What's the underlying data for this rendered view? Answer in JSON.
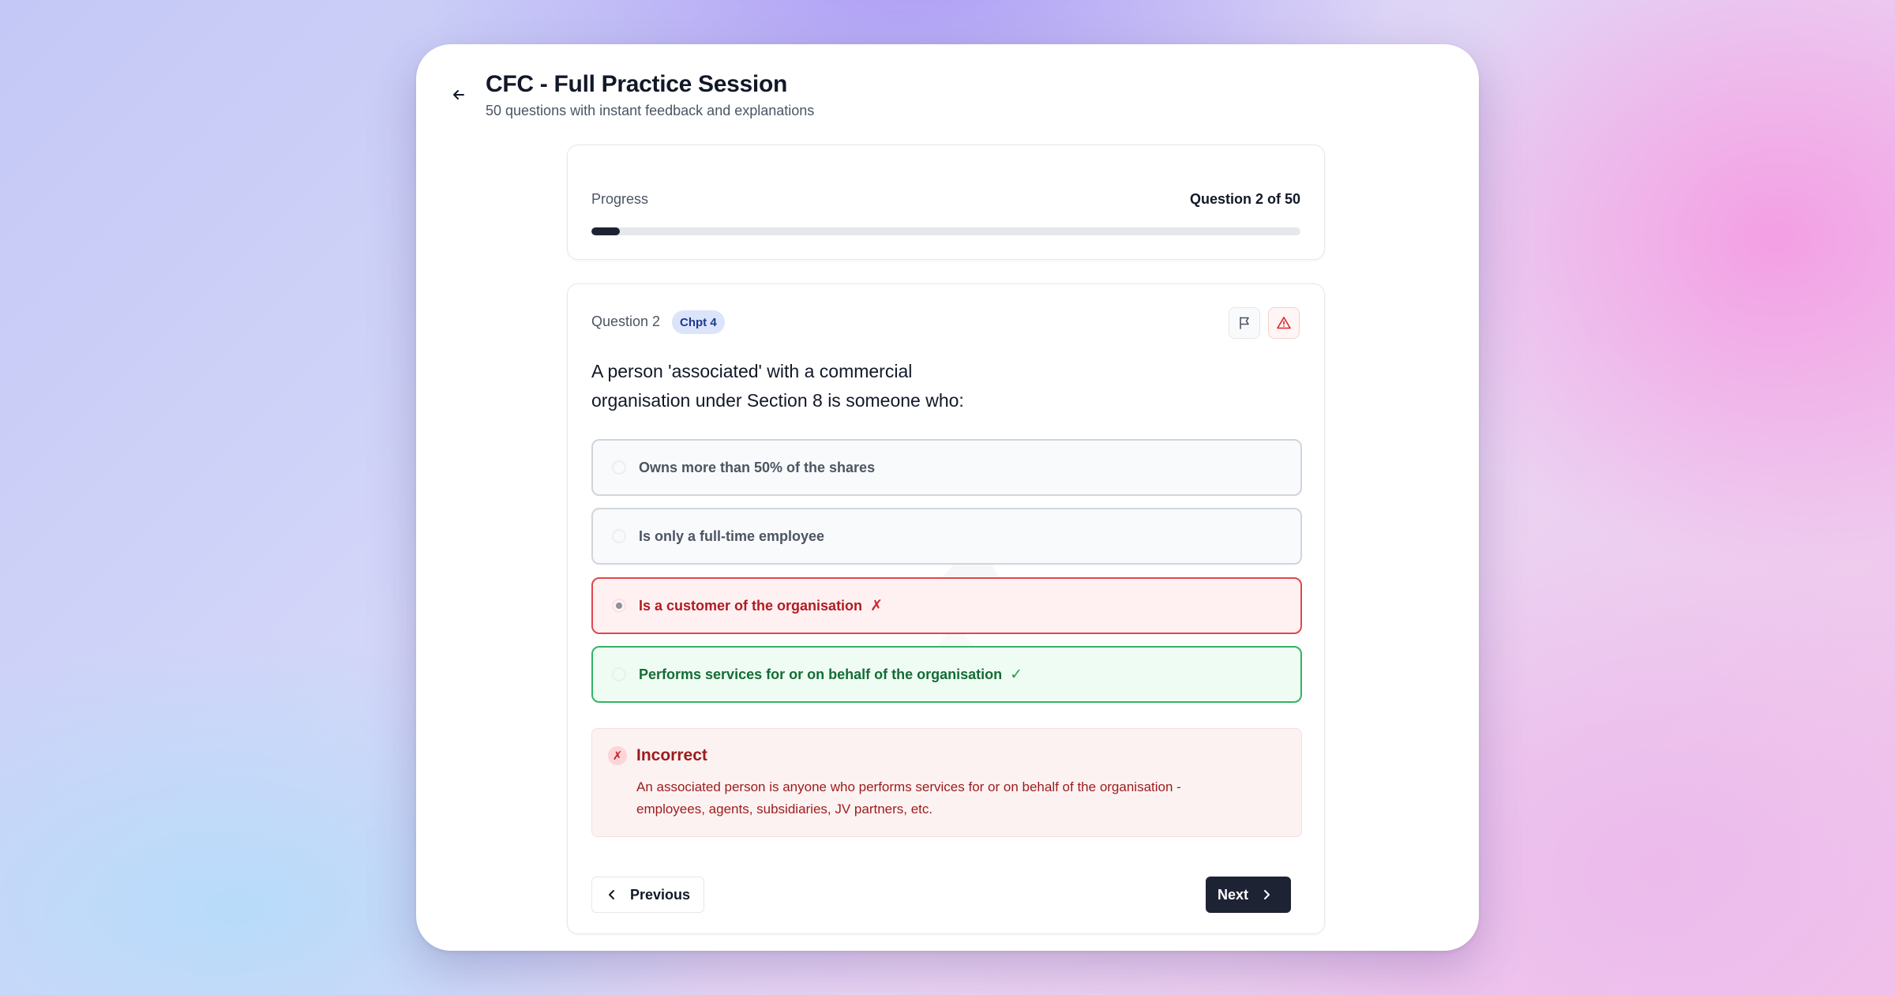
{
  "header": {
    "title": "CFC - Full Practice Session",
    "subtitle": "50 questions with instant feedback and explanations"
  },
  "progress": {
    "label": "Progress",
    "count_text": "Question 2 of 50",
    "current": 2,
    "total": 50,
    "fill_fraction": 0.04
  },
  "question": {
    "number_label": "Question 2",
    "chapter_badge": "Chpt 4",
    "text": "A person 'associated' with a commercial organisation under Section 8 is someone who:",
    "options": [
      {
        "label": "Owns more than 50% of the shares",
        "state": "neutral",
        "mark": ""
      },
      {
        "label": "Is only a full-time employee",
        "state": "neutral",
        "mark": ""
      },
      {
        "label": "Is a customer of the organisation",
        "state": "selected-incorrect",
        "mark": "✗"
      },
      {
        "label": "Performs services for or on behalf of the organisation",
        "state": "correct",
        "mark": "✓"
      }
    ]
  },
  "feedback": {
    "icon": "✗",
    "title": "Incorrect",
    "body": "An associated person is anyone who performs services for or on behalf of the organisation - employees, agents, subsidiaries, JV partners, etc."
  },
  "nav": {
    "previous_label": "Previous",
    "next_label": "Next"
  },
  "icons": {
    "back": "arrow-left-icon",
    "flag": "flag-icon",
    "report": "alert-triangle-icon",
    "prev": "chevron-left-icon",
    "next": "chevron-right-icon"
  },
  "colors": {
    "primary_dark": "#1e2334",
    "incorrect": "#e0474c",
    "correct": "#34b363",
    "badge_bg": "#dbe4fb"
  }
}
